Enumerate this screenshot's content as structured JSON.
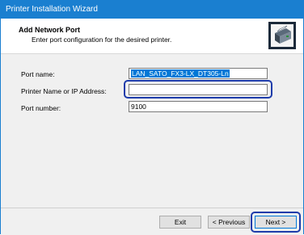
{
  "window": {
    "title": "Printer Installation Wizard"
  },
  "header": {
    "heading": "Add Network Port",
    "subheading": "Enter port configuration for the desired printer.",
    "icon": "printer-icon"
  },
  "form": {
    "port_name_label": "Port name:",
    "port_name_value": "LAN_SATO_FX3-LX_DT305-Ln",
    "address_label": "Printer Name or IP Address:",
    "address_value": "",
    "port_number_label": "Port number:",
    "port_number_value": "9100"
  },
  "buttons": {
    "exit": "Exit",
    "previous": "< Previous",
    "next": "Next >"
  },
  "colors": {
    "titlebar": "#1a7fd0",
    "selection": "#0078d7",
    "highlight": "#1e3caa"
  }
}
